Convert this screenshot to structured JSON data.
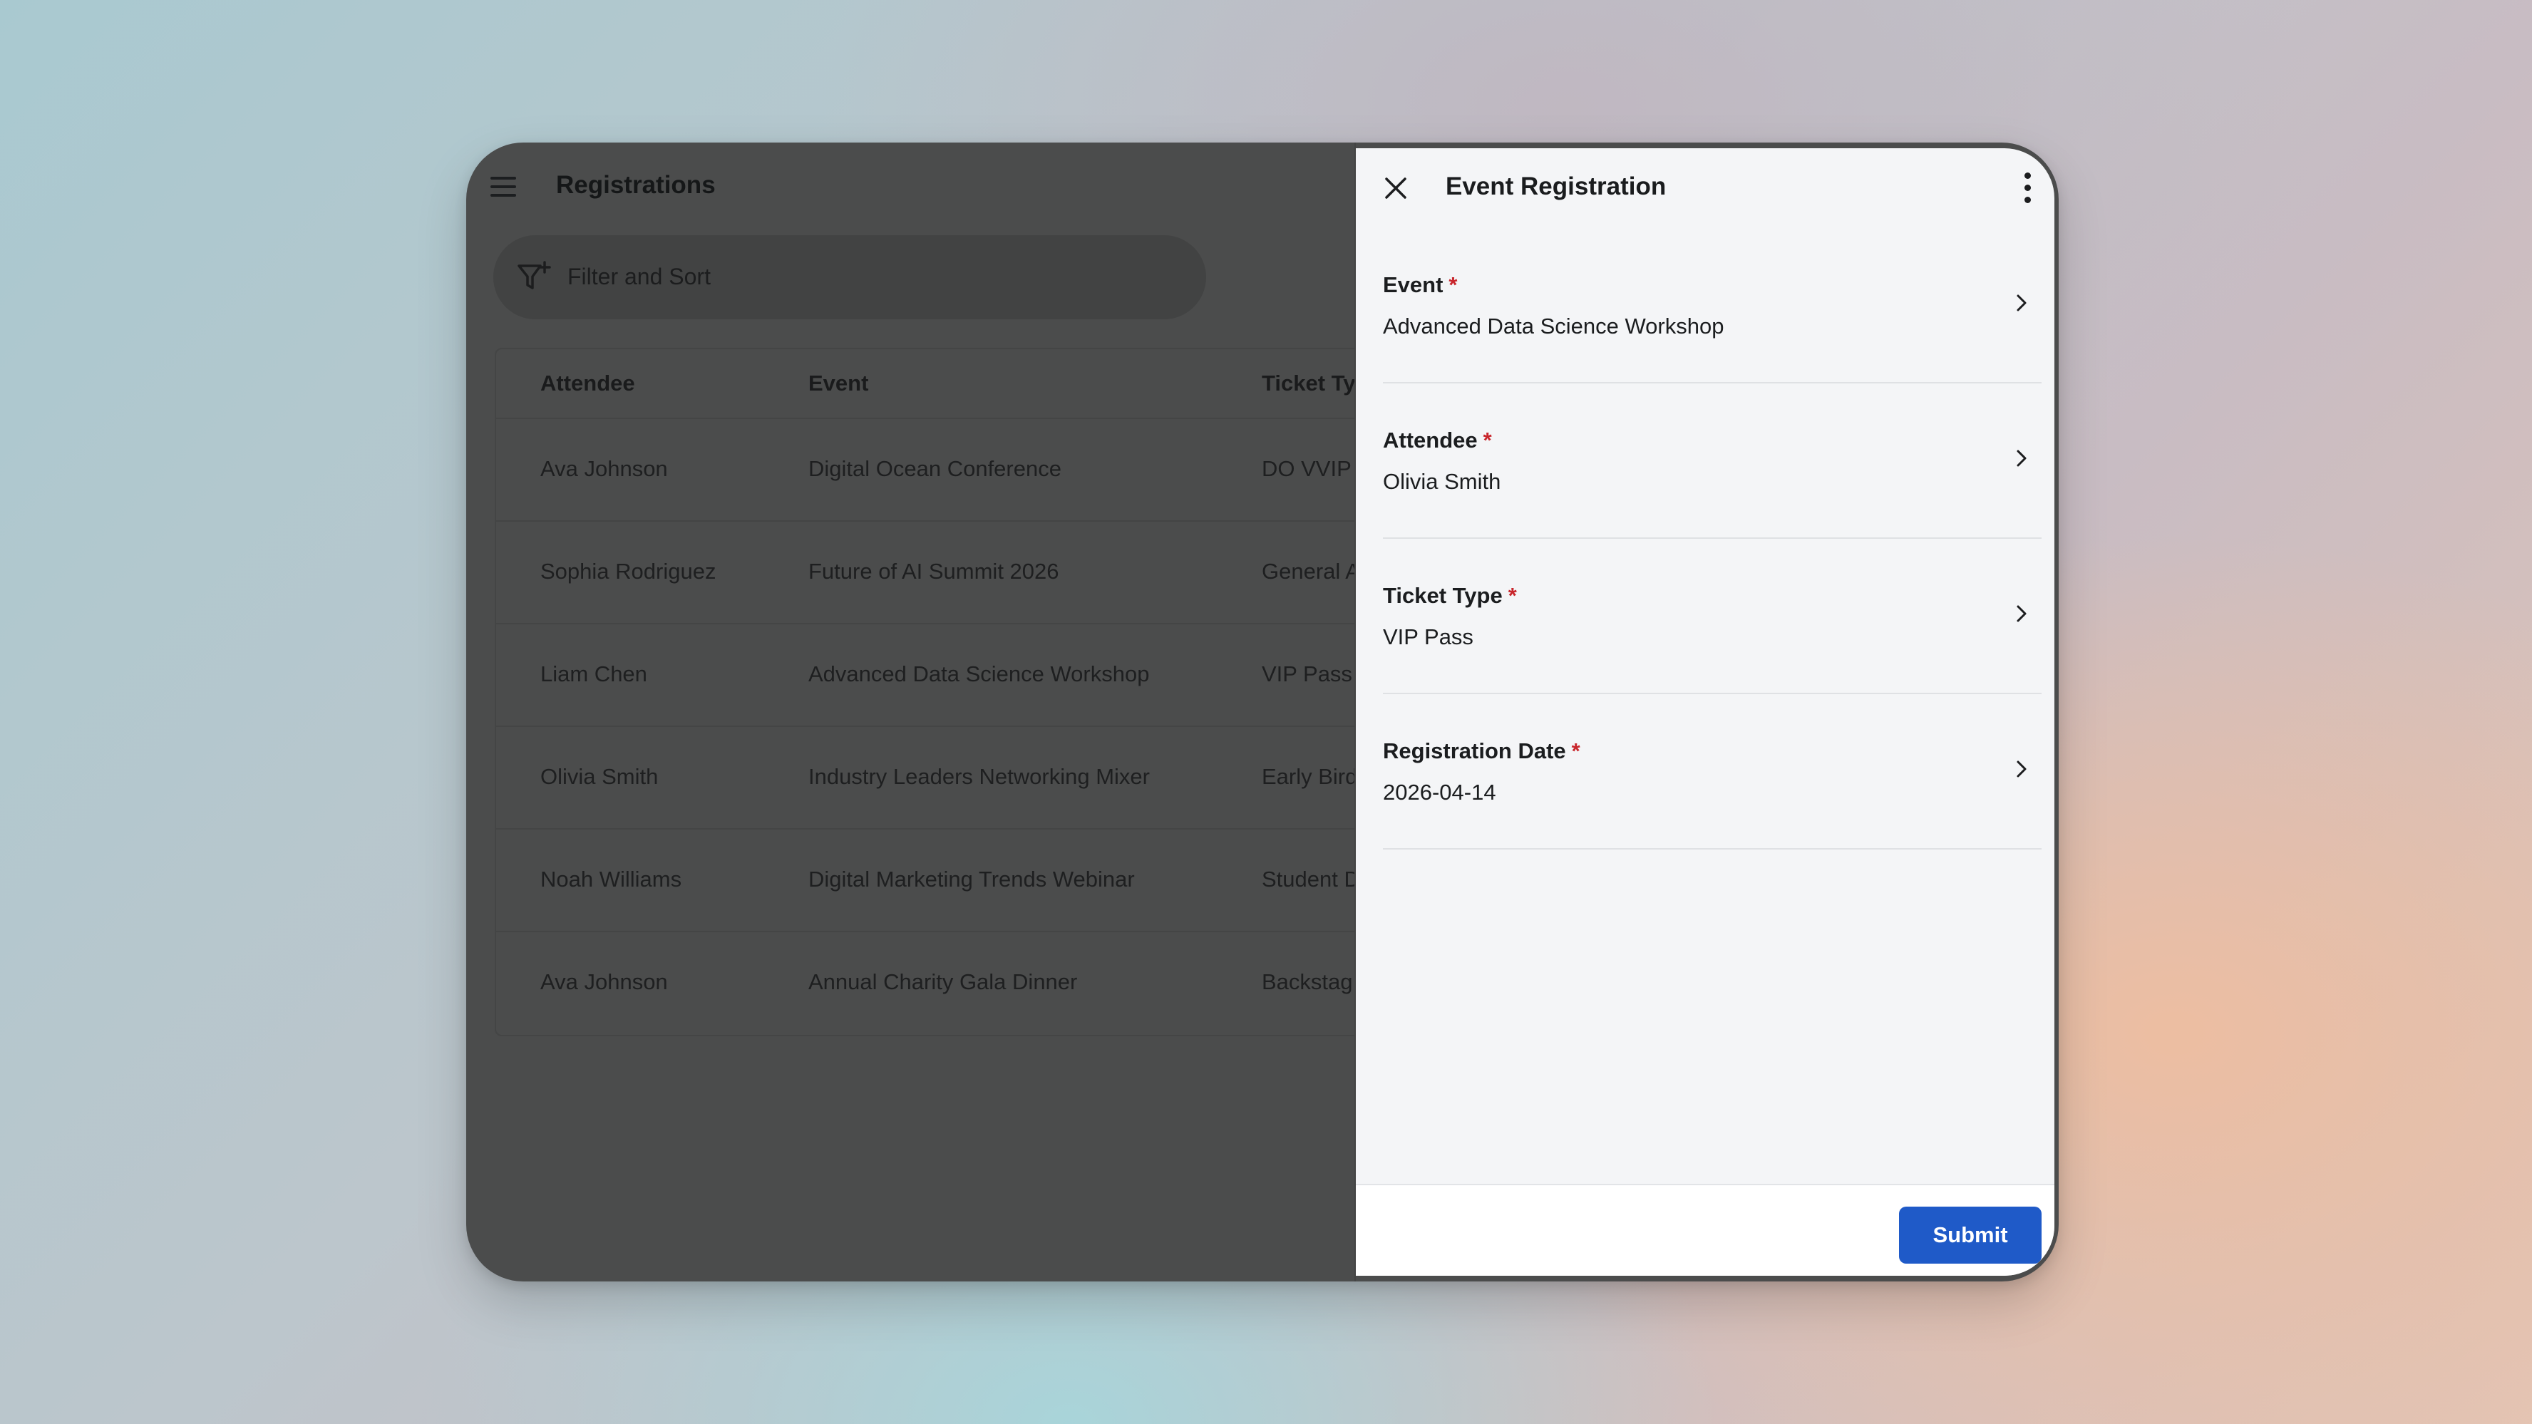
{
  "app": {
    "title": "Registrations",
    "search_placeholder": "Filter and Sort"
  },
  "table": {
    "columns": [
      "Attendee",
      "Event",
      "Ticket Ty"
    ],
    "rows": [
      {
        "attendee": "Ava Johnson",
        "event": "Digital Ocean Conference",
        "ticket": "DO VVIP"
      },
      {
        "attendee": "Sophia Rodriguez",
        "event": "Future of AI Summit 2026",
        "ticket": "General A"
      },
      {
        "attendee": "Liam Chen",
        "event": "Advanced Data Science Workshop",
        "ticket": "VIP Pass"
      },
      {
        "attendee": "Olivia Smith",
        "event": "Industry Leaders Networking Mixer",
        "ticket": "Early Bird"
      },
      {
        "attendee": "Noah Williams",
        "event": "Digital Marketing Trends Webinar",
        "ticket": "Student D"
      },
      {
        "attendee": "Ava Johnson",
        "event": "Annual Charity Gala Dinner",
        "ticket": "Backstag"
      }
    ]
  },
  "panel": {
    "title": "Event Registration",
    "required_mark": "*",
    "fields": [
      {
        "label": "Event",
        "value": "Advanced Data Science Workshop"
      },
      {
        "label": "Attendee",
        "value": "Olivia Smith"
      },
      {
        "label": "Ticket Type",
        "value": "VIP Pass"
      },
      {
        "label": "Registration Date",
        "value": "2026-04-14"
      }
    ],
    "submit_label": "Submit"
  },
  "colors": {
    "accent": "#1f5ac8",
    "required": "#c8252b",
    "overlay": "#4b4c4c",
    "panel_bg": "#f4f5f7"
  },
  "icons": [
    "menu-icon",
    "filter-add-icon",
    "close-icon",
    "more-vertical-icon",
    "chevron-right-icon"
  ]
}
